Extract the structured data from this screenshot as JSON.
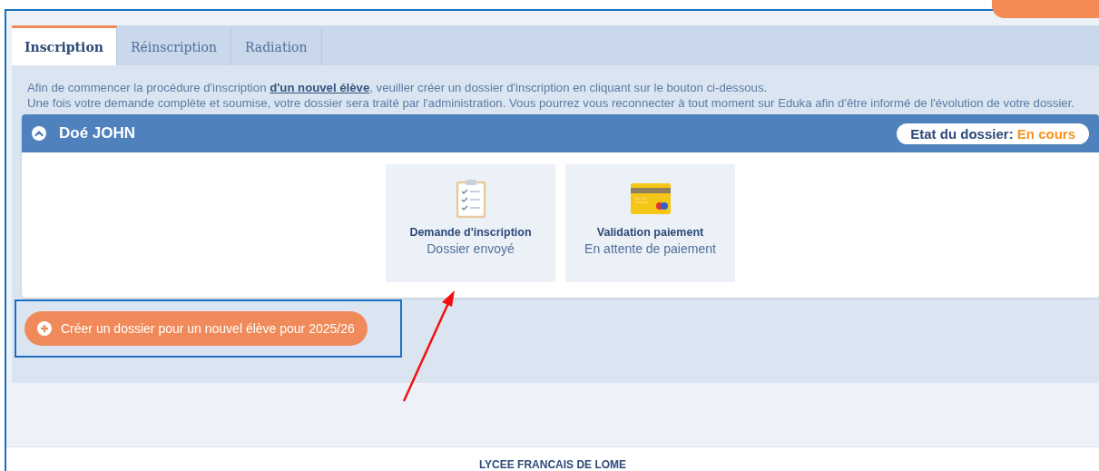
{
  "tabs": [
    {
      "label": "Inscription",
      "selected": true
    },
    {
      "label": "Réinscription",
      "selected": false
    },
    {
      "label": "Radiation",
      "selected": false
    }
  ],
  "intro": "Afin de commencer la procédure d'inscription **d'un nouvel élève**, veuiller créer un dossier d'inscription en cliquant sur le bouton ci-dessous.\nUne fois votre demande complète et soumise, votre dossier sera traité par l'administration. Vous pourrez vous reconnecter à tout moment sur Eduka afin d'être informé de l'évolution de votre dossier.",
  "student_panel": {
    "name": "Doé JOHN",
    "expanded": true,
    "status_label": "Etat du dossier:",
    "status_value": "En cours",
    "steps": [
      {
        "kind": "form",
        "title": "Demande d'inscription",
        "status": "Dossier envoyé"
      },
      {
        "kind": "payment",
        "title": "Validation paiement",
        "status": "En attente de paiement"
      }
    ]
  },
  "create_button": "Créer un dossier pour un nouvel élève pour 2025/26",
  "footer": "LYCEE FRANCAIS DE LOME"
}
